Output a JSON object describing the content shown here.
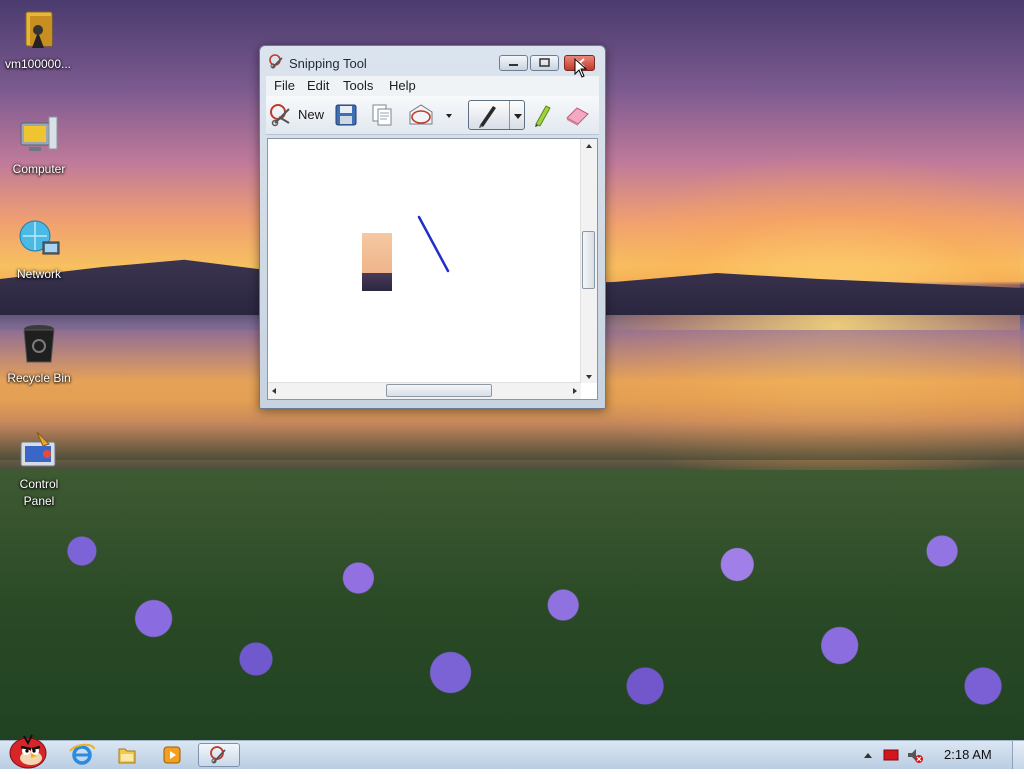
{
  "desktop": {
    "icons": [
      {
        "label": "vm100000...",
        "icon": "folder-zip-icon"
      },
      {
        "label": "Computer",
        "icon": "computer-icon"
      },
      {
        "label": "Network",
        "icon": "network-icon"
      },
      {
        "label": "Recycle Bin",
        "icon": "recycle-bin-icon"
      },
      {
        "label": "Control Panel",
        "icon": "control-panel-icon"
      }
    ]
  },
  "window": {
    "title": "Snipping Tool",
    "menu": [
      "File",
      "Edit",
      "Tools",
      "Help"
    ],
    "toolbar": {
      "new_label": "New"
    },
    "colors": {
      "pen_stroke": "#1f2fc8",
      "snip_top": "#f2c89a",
      "snip_bottom": "#2f2c4a"
    }
  },
  "taskbar": {
    "time": "2:18 AM",
    "pinned": [
      "angry-bird-start-icon",
      "internet-explorer-icon",
      "file-explorer-icon",
      "media-player-icon",
      "snipping-tool-icon"
    ]
  }
}
